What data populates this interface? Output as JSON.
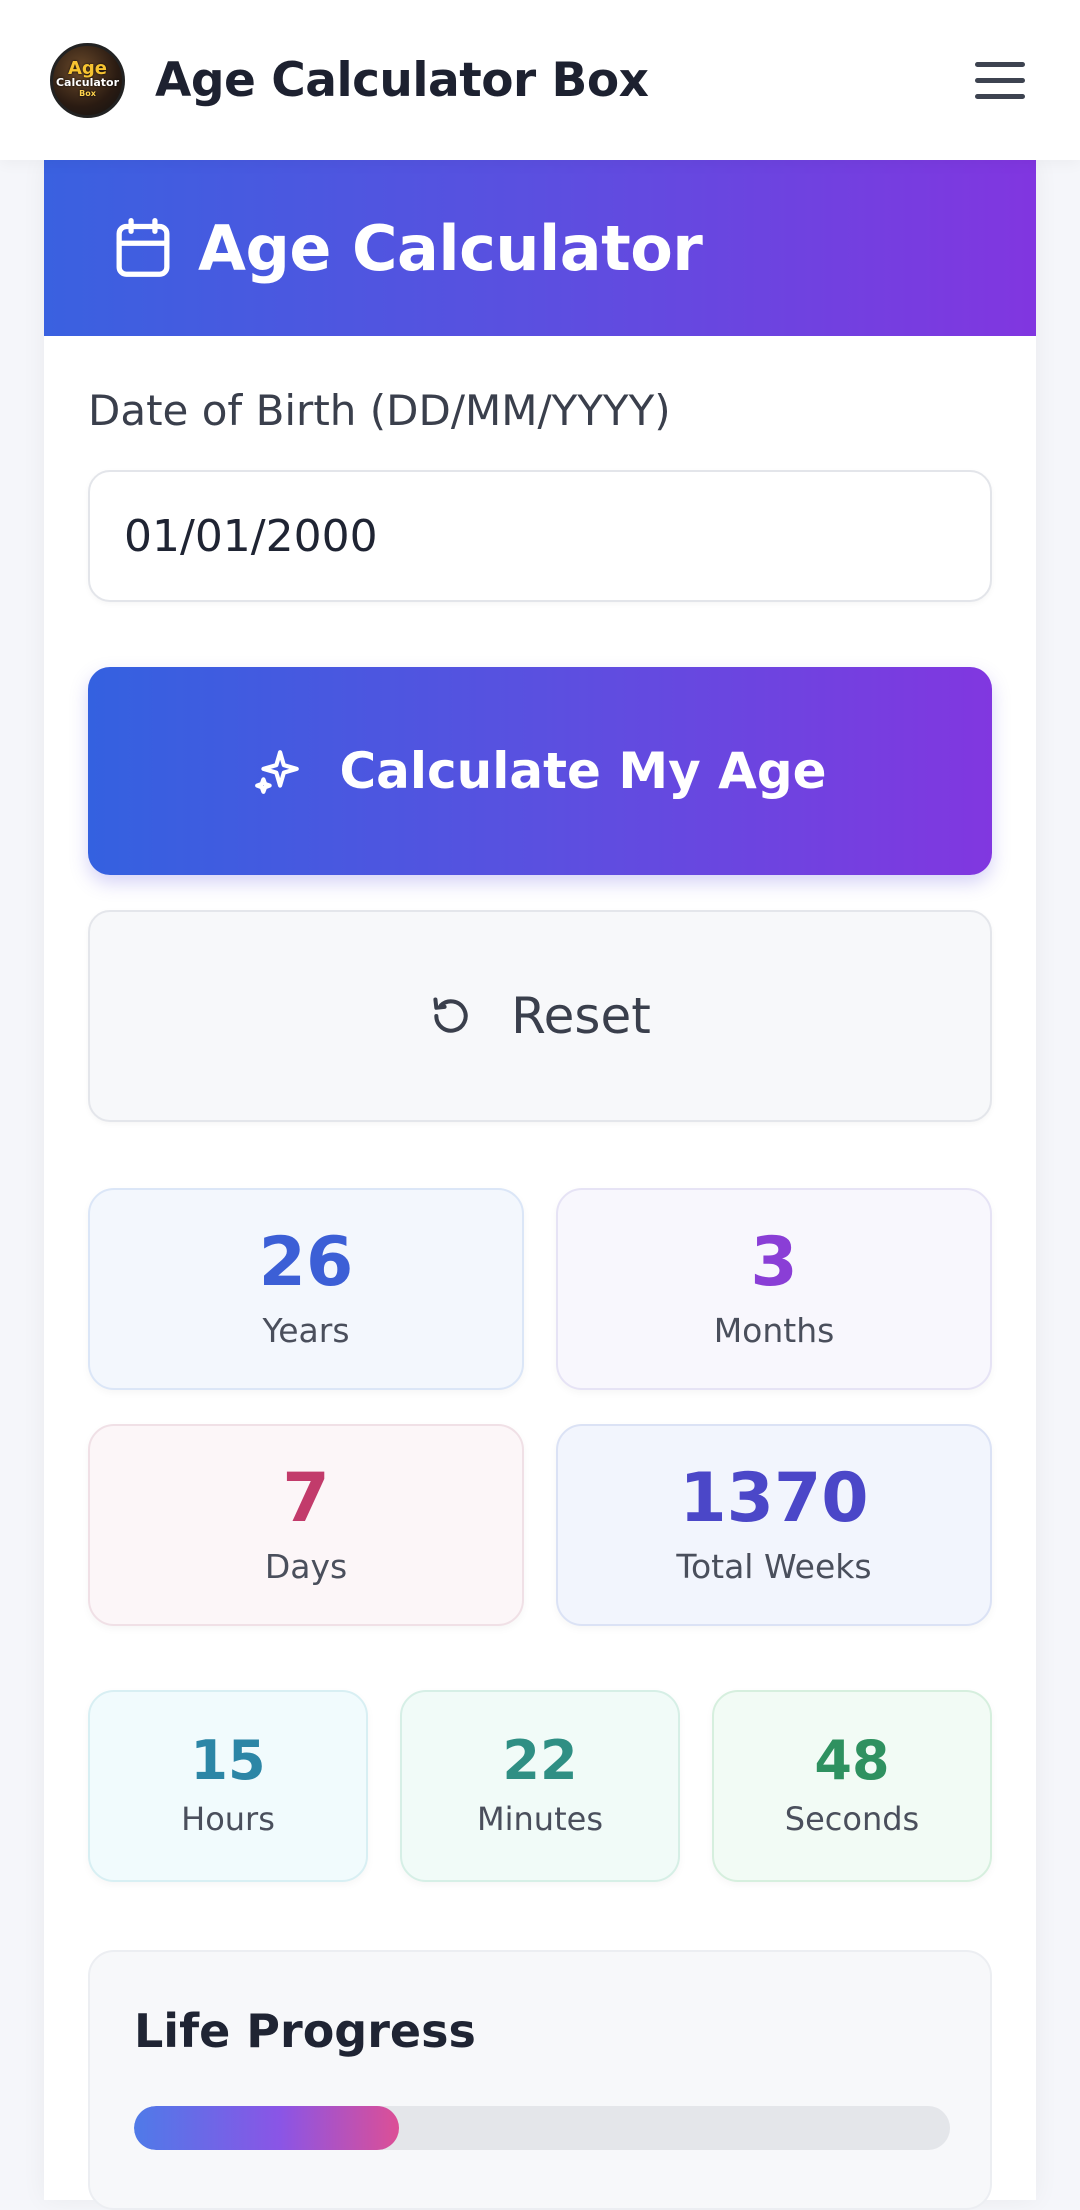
{
  "header": {
    "app_title": "Age Calculator Box",
    "logo_line1": "Age",
    "logo_line2": "Calculator",
    "logo_line3": "Box",
    "logo_icon": "app-logo",
    "menu_icon": "hamburger-menu-icon"
  },
  "calculator": {
    "title": "Age Calculator",
    "title_icon": "calendar-icon",
    "dob_label": "Date of Birth (DD/MM/YYYY)",
    "dob_value": "01/01/2000",
    "calculate_label": "Calculate My Age",
    "calculate_icon": "sparkle-icon",
    "reset_label": "Reset",
    "reset_icon": "reset-icon"
  },
  "results": {
    "years": {
      "value": "26",
      "label": "Years"
    },
    "months": {
      "value": "3",
      "label": "Months"
    },
    "days": {
      "value": "7",
      "label": "Days"
    },
    "total_weeks": {
      "value": "1370",
      "label": "Total Weeks"
    },
    "hours": {
      "value": "15",
      "label": "Hours"
    },
    "minutes": {
      "value": "22",
      "label": "Minutes"
    },
    "seconds": {
      "value": "48",
      "label": "Seconds"
    }
  },
  "life_progress": {
    "title": "Life Progress",
    "percent": 32.5
  },
  "colors": {
    "accent_start": "#3461e0",
    "accent_end": "#8137e0"
  }
}
